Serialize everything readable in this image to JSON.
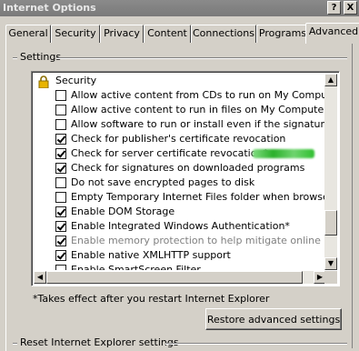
{
  "window": {
    "title": "Internet Options",
    "help_button": "?",
    "close_button": "X"
  },
  "tabs": [
    {
      "label": "General"
    },
    {
      "label": "Security"
    },
    {
      "label": "Privacy"
    },
    {
      "label": "Content"
    },
    {
      "label": "Connections"
    },
    {
      "label": "Programs"
    },
    {
      "label": "Advanced",
      "active": true
    }
  ],
  "settings": {
    "group_label": "Settings",
    "category": "Security",
    "items": [
      {
        "label": "Allow active content from CDs to run on My Computer*",
        "checked": false
      },
      {
        "label": "Allow active content to run in files on My Computer*",
        "checked": false
      },
      {
        "label": "Allow software to run or install even if the signature is inva",
        "checked": false
      },
      {
        "label": "Check for publisher's certificate revocation",
        "checked": true
      },
      {
        "label": "Check for server certificate revocation*",
        "checked": true
      },
      {
        "label": "Check for signatures on downloaded programs",
        "checked": true
      },
      {
        "label": "Do not save encrypted pages to disk",
        "checked": false
      },
      {
        "label": "Empty Temporary Internet Files folder when browser is clo",
        "checked": false
      },
      {
        "label": "Enable DOM Storage",
        "checked": true
      },
      {
        "label": "Enable Integrated Windows Authentication*",
        "checked": true
      },
      {
        "label": "Enable memory protection to help mitigate online attacks*",
        "checked": true,
        "disabled": true
      },
      {
        "label": "Enable native XMLHTTP support",
        "checked": true
      },
      {
        "label": "Enable SmartScreen Filter",
        "checked": false
      }
    ]
  },
  "note": "*Takes effect after you restart Internet Explorer",
  "restore_button": "Restore advanced settings",
  "reset_group_label": "Reset Internet Explorer settings"
}
